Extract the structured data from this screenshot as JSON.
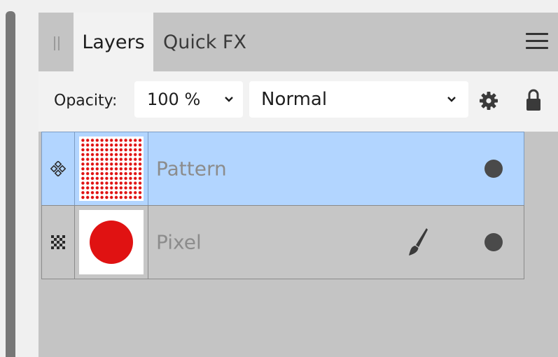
{
  "tabs": [
    {
      "label": "Layers",
      "active": true
    },
    {
      "label": "Quick FX",
      "active": false
    }
  ],
  "toolbar": {
    "opacity_label": "Opacity:",
    "opacity_value": "100 %",
    "blend_mode": "Normal"
  },
  "layers": [
    {
      "name": "Pattern",
      "selected": true,
      "type_icon": "pattern-layer-icon",
      "thumbnail": "red-dot-grid"
    },
    {
      "name": "Pixel",
      "selected": false,
      "type_icon": "pixel-layer-icon",
      "thumbnail": "red-circle"
    }
  ],
  "icons": {
    "panel_menu": "hamburger-menu-icon",
    "settings": "gear-icon",
    "lock": "lock-icon",
    "brush": "brush-icon",
    "visibility": "visibility-dot-icon"
  },
  "colors": {
    "selected_row": "#b2d5ff",
    "panel_bg": "#c4c4c4",
    "toolbar_bg": "#f2f2f2",
    "thumbnail_red": "#e01212"
  }
}
